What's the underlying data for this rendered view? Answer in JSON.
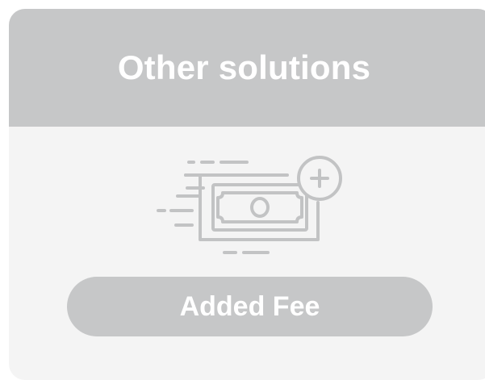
{
  "card": {
    "title": "Other solutions",
    "icon": "money-plus-icon",
    "button_label": "Added Fee"
  },
  "colors": {
    "header_bg": "#c6c7c8",
    "card_bg": "#f4f4f4",
    "button_bg": "#c6c7c8",
    "icon_stroke": "#c2c3c4",
    "text": "#ffffff"
  }
}
